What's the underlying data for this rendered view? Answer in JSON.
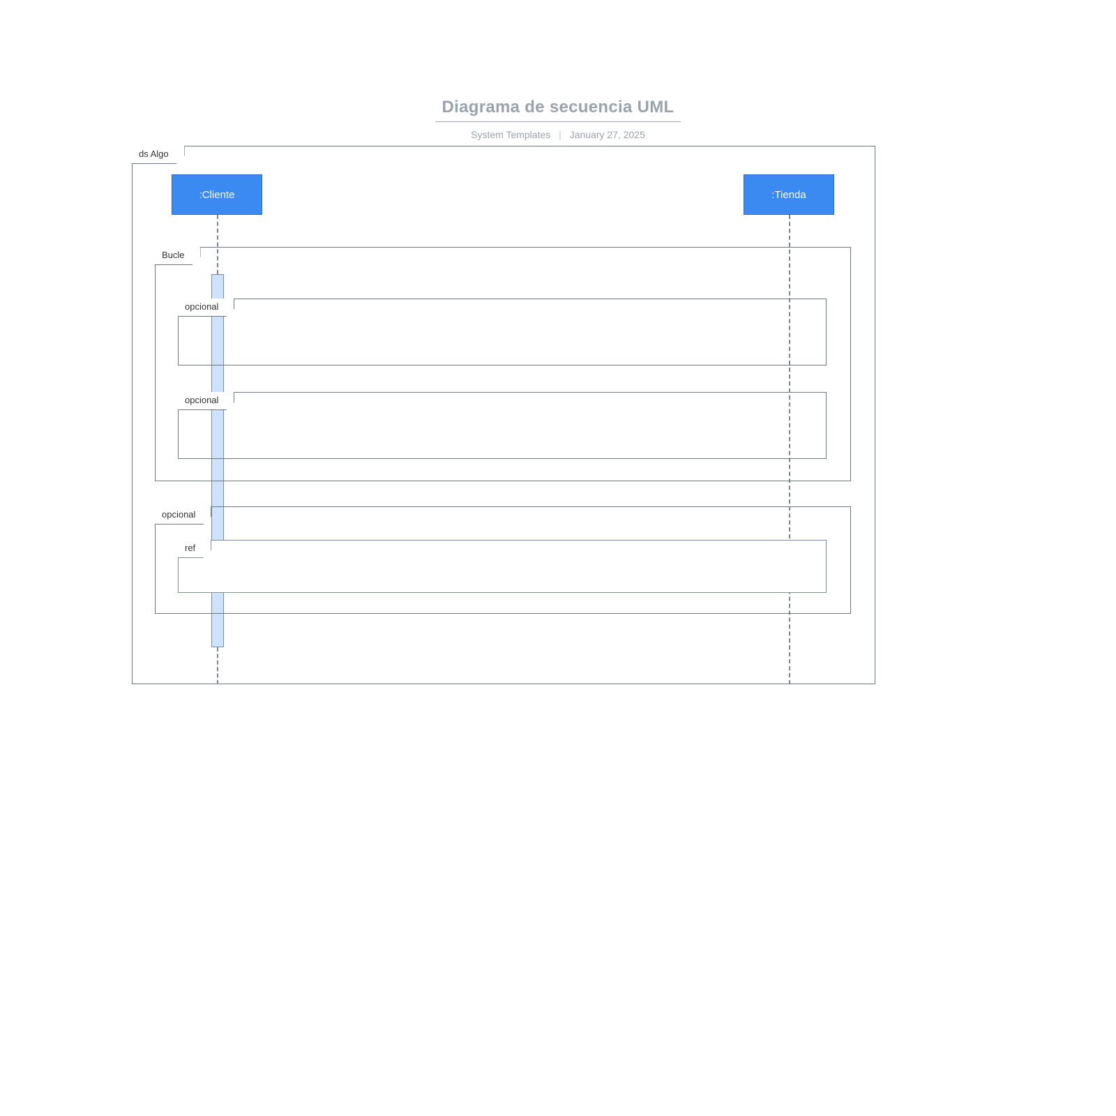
{
  "title": "Diagrama de secuencia UML",
  "meta": {
    "author": "System Templates",
    "date": "January 27, 2025"
  },
  "diagram": {
    "frame_label": "ds Algo",
    "lifelines": {
      "cliente": ":Cliente",
      "tienda": ":Tienda"
    },
    "fragments": {
      "loop": "Bucle",
      "opt1": "opcional",
      "opt2": "opcional",
      "opt3": "opcional",
      "ref": "ref"
    }
  }
}
